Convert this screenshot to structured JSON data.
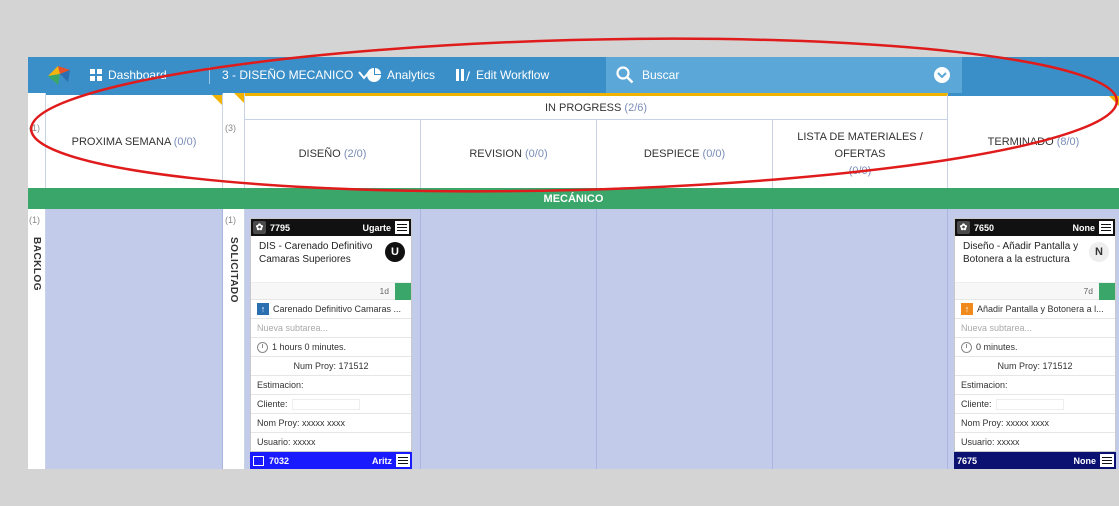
{
  "topbar": {
    "dashboard_label": "Dashboard",
    "board_selector_label": "3 - DISEÑO MECANICO",
    "analytics_label": "Analytics",
    "edit_workflow_label": "Edit Workflow",
    "search_placeholder": "Buscar"
  },
  "header": {
    "backlog_count": "(1)",
    "proxima_semana": {
      "label": "PROXIMA SEMANA",
      "count": "(0/0)"
    },
    "solicitado_count": "(3)",
    "in_progress": {
      "label": "IN PROGRESS",
      "count": "(2/6)"
    },
    "diseno": {
      "label": "DISEÑO",
      "count": "(2/0)"
    },
    "revision": {
      "label": "REVISION",
      "count": "(0/0)"
    },
    "despiece": {
      "label": "DESPIECE",
      "count": "(0/0)"
    },
    "lista": {
      "label": "LISTA DE MATERIALES / OFERTAS",
      "count": "(0/0)"
    },
    "terminado": {
      "label": "TERMINADO",
      "count": "(8/0)"
    }
  },
  "lane_group": "MECÁNICO",
  "lanes": {
    "backlog": {
      "count": "(1)",
      "label": "BACKLOG"
    },
    "solicitado": {
      "count": "(1)",
      "label": "SOLICITADO"
    }
  },
  "cards": [
    {
      "id": "7795",
      "owner": "Ugarte",
      "title": "DIS - Carenado Definitivo Camaras Superiores",
      "avatar": "U",
      "age": "1d",
      "parent": "Carenado Definitivo Camaras ...",
      "subtask_placeholder": "Nueva subtarea...",
      "time": "1 hours 0 minutes.",
      "num_proy": "Num Proy: 171512",
      "estimacion": "Estimacion:",
      "cliente": "Cliente:",
      "nom_proy": "Nom Proy: xxxxx xxxx",
      "usuario": "Usuario: xxxxx"
    },
    {
      "id": "7650",
      "owner": "None",
      "title": "Diseño - Añadir Pantalla y Botonera a la estructura",
      "avatar": "N",
      "age": "7d",
      "parent": "Añadir Pantalla y Botonera a l...",
      "subtask_placeholder": "Nueva subtarea...",
      "time": "0 minutes.",
      "num_proy": "Num Proy: 171512",
      "estimacion": "Estimacion:",
      "cliente": "Cliente:",
      "nom_proy": "Nom Proy: xxxxx xxxx",
      "usuario": "Usuario: xxxxx"
    }
  ],
  "mini_cards": [
    {
      "id": "7032",
      "owner": "Aritz",
      "color": "#1a1aff"
    },
    {
      "id": "7675",
      "owner": "None",
      "color": "#0a1170"
    }
  ],
  "colors": {
    "topbar": "#3a8fc8",
    "search": "#5aa7d8",
    "lane_group": "#3aa66a",
    "column_bg": "#c2ccea",
    "annotation": "#e01b1b"
  }
}
